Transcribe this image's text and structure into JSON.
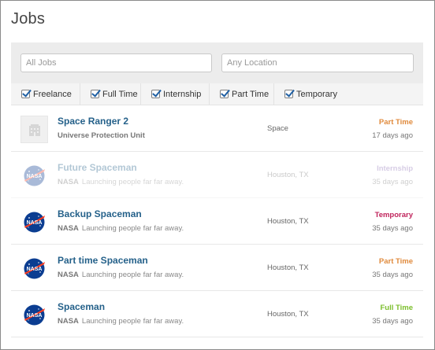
{
  "page": {
    "title": "Jobs"
  },
  "search": {
    "keywords_placeholder": "All Jobs",
    "location_placeholder": "Any Location"
  },
  "filters": [
    {
      "label": "Freelance",
      "checked": true
    },
    {
      "label": "Full Time",
      "checked": true
    },
    {
      "label": "Internship",
      "checked": true
    },
    {
      "label": "Part Time",
      "checked": true
    },
    {
      "label": "Temporary",
      "checked": true
    }
  ],
  "jobs": [
    {
      "title": "Space Ranger 2",
      "company": "Universe Protection Unit",
      "tagline": "",
      "location": "Space",
      "type": "Part Time",
      "type_color": "#e08a3c",
      "posted": "17 days ago",
      "logo": "building-placeholder-icon",
      "faded": false
    },
    {
      "title": "Future Spaceman",
      "company": "NASA",
      "tagline": "Launching people far far away.",
      "location": "Houston, TX",
      "type": "Internship",
      "type_color": "#8b6fb5",
      "posted": "35 days ago",
      "logo": "nasa-logo-icon",
      "faded": true
    },
    {
      "title": "Backup Spaceman",
      "company": "NASA",
      "tagline": "Launching people far far away.",
      "location": "Houston, TX",
      "type": "Temporary",
      "type_color": "#c0245c",
      "posted": "35 days ago",
      "logo": "nasa-logo-icon",
      "faded": false
    },
    {
      "title": "Part time Spaceman",
      "company": "NASA",
      "tagline": "Launching people far far away.",
      "location": "Houston, TX",
      "type": "Part Time",
      "type_color": "#e08a3c",
      "posted": "35 days ago",
      "logo": "nasa-logo-icon",
      "faded": false
    },
    {
      "title": "Spaceman",
      "company": "NASA",
      "tagline": "Launching people far far away.",
      "location": "Houston, TX",
      "type": "Full Time",
      "type_color": "#7bbe2b",
      "posted": "35 days ago",
      "logo": "nasa-logo-icon",
      "faded": false
    }
  ]
}
